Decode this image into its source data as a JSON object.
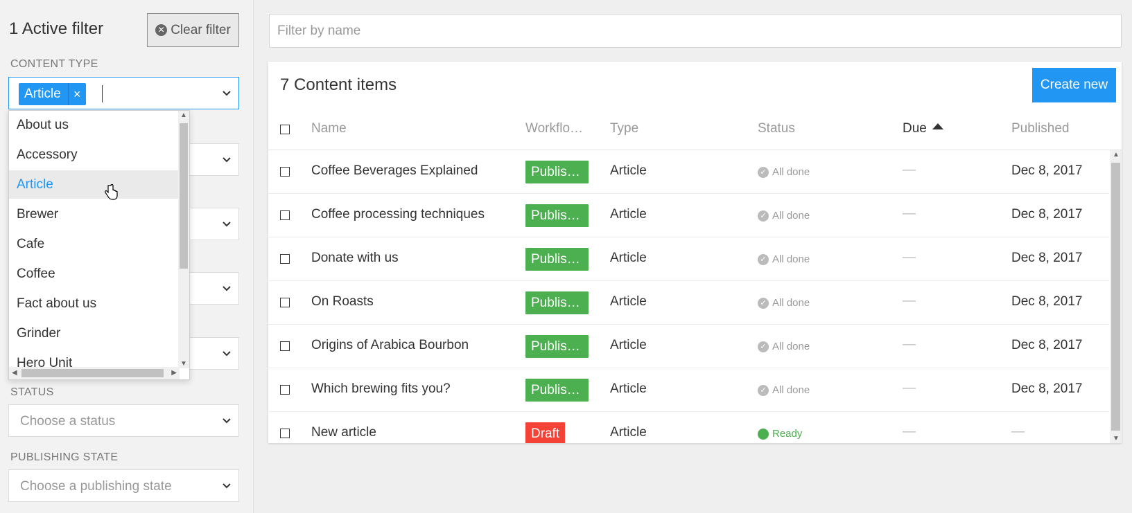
{
  "sidebar": {
    "active_filter_title": "1 Active filter",
    "clear_filter_label": "Clear filter",
    "content_type_label": "CONTENT TYPE",
    "selected_chip": "Article",
    "chip_remove": "×",
    "status_label": "STATUS",
    "status_placeholder": "Choose a status",
    "publishing_state_label": "PUBLISHING STATE",
    "publishing_state_placeholder": "Choose a publishing state",
    "dropdown_options": [
      "About us",
      "Accessory",
      "Article",
      "Brewer",
      "Cafe",
      "Coffee",
      "Fact about us",
      "Grinder",
      "Hero Unit"
    ],
    "hovered_option": "Article"
  },
  "main": {
    "filter_placeholder": "Filter by name",
    "panel_title": "7 Content items",
    "create_new_label": "Create new",
    "columns": {
      "name": "Name",
      "workflow": "Workflo…",
      "type": "Type",
      "status": "Status",
      "due": "Due",
      "published": "Published"
    },
    "rows": [
      {
        "name": "Coffee Beverages Explained",
        "workflow": "Publis…",
        "type": "Article",
        "status": "All done",
        "due": "—",
        "published": "Dec 8, 2017"
      },
      {
        "name": "Coffee processing techniques",
        "workflow": "Publis…",
        "type": "Article",
        "status": "All done",
        "due": "—",
        "published": "Dec 8, 2017"
      },
      {
        "name": "Donate with us",
        "workflow": "Publis…",
        "type": "Article",
        "status": "All done",
        "due": "—",
        "published": "Dec 8, 2017"
      },
      {
        "name": "On Roasts",
        "workflow": "Publis…",
        "type": "Article",
        "status": "All done",
        "due": "—",
        "published": "Dec 8, 2017"
      },
      {
        "name": "Origins of Arabica Bourbon",
        "workflow": "Publis…",
        "type": "Article",
        "status": "All done",
        "due": "—",
        "published": "Dec 8, 2017"
      },
      {
        "name": "Which brewing fits you?",
        "workflow": "Publis…",
        "type": "Article",
        "status": "All done",
        "due": "—",
        "published": "Dec 8, 2017"
      },
      {
        "name": "New article",
        "workflow": "Draft",
        "type": "Article",
        "status": "Ready",
        "due": "—",
        "published": "—"
      }
    ]
  },
  "colors": {
    "accent": "#2196f3",
    "published": "#4caf50",
    "draft": "#f44336"
  }
}
